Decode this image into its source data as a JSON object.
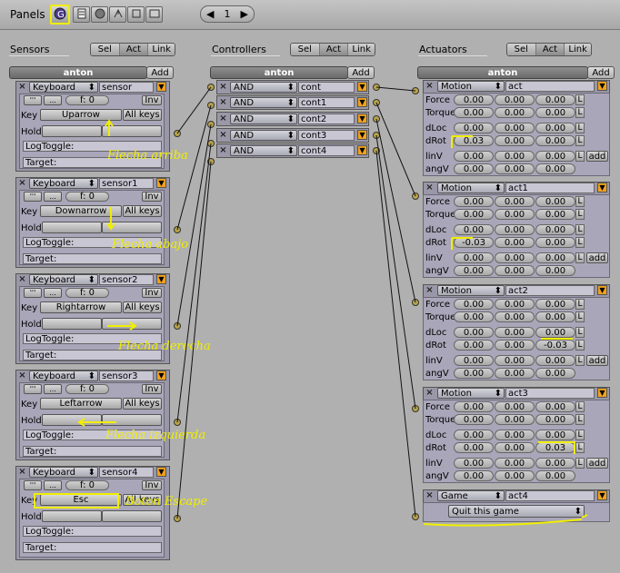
{
  "header": {
    "panels_label": "Panels",
    "page_number": "1",
    "tool_icons": [
      "logic-icon",
      "script-icon",
      "shading-icon",
      "object-icon",
      "editing-icon",
      "scene-icon"
    ]
  },
  "sensors": {
    "title": "Sensors",
    "filters": [
      "Sel",
      "Act",
      "Link"
    ],
    "object": "anton",
    "add": "Add",
    "bricks": [
      {
        "type": "Keyboard",
        "name": "sensor",
        "freq": "f: 0",
        "inv": "Inv",
        "key_label": "Key",
        "key": "Uparrow",
        "all_keys": "All keys",
        "hold": "Hold",
        "logtoggle": "LogToggle:",
        "target": "Target:",
        "note": "Flecha arriba"
      },
      {
        "type": "Keyboard",
        "name": "sensor1",
        "freq": "f: 0",
        "inv": "Inv",
        "key_label": "Key",
        "key": "Downarrow",
        "all_keys": "All keys",
        "hold": "Hold",
        "logtoggle": "LogToggle:",
        "target": "Target:",
        "note": "Flecha abajo"
      },
      {
        "type": "Keyboard",
        "name": "sensor2",
        "freq": "f: 0",
        "inv": "Inv",
        "key_label": "Key",
        "key": "Rightarrow",
        "all_keys": "All keys",
        "hold": "Hold",
        "logtoggle": "LogToggle:",
        "target": "Target:",
        "note": "Flecha derecha"
      },
      {
        "type": "Keyboard",
        "name": "sensor3",
        "freq": "f: 0",
        "inv": "Inv",
        "key_label": "Key",
        "key": "Leftarrow",
        "all_keys": "All keys",
        "hold": "Hold",
        "logtoggle": "LogToggle:",
        "target": "Target:",
        "note": "Flecha izquierda"
      },
      {
        "type": "Keyboard",
        "name": "sensor4",
        "freq": "f: 0",
        "inv": "Inv",
        "key_label": "Key",
        "key": "Esc",
        "all_keys": "All keys",
        "hold": "Hold",
        "logtoggle": "LogToggle:",
        "target": "Target:",
        "note": "Boton Escape"
      }
    ]
  },
  "controllers": {
    "title": "Controllers",
    "filters": [
      "Sel",
      "Act",
      "Link"
    ],
    "object": "anton",
    "add": "Add",
    "bricks": [
      {
        "type": "AND",
        "name": "cont"
      },
      {
        "type": "AND",
        "name": "cont1"
      },
      {
        "type": "AND",
        "name": "cont2"
      },
      {
        "type": "AND",
        "name": "cont3"
      },
      {
        "type": "AND",
        "name": "cont4"
      }
    ]
  },
  "actuators": {
    "title": "Actuators",
    "filters": [
      "Sel",
      "Act",
      "Link"
    ],
    "object": "anton",
    "add": "Add",
    "row_labels": {
      "force": "Force",
      "torque": "Torque",
      "dloc": "dLoc",
      "drot": "dRot",
      "linv": "linV",
      "angv": "angV",
      "l": "L",
      "add": "add"
    },
    "bricks": [
      {
        "type": "Motion",
        "name": "act",
        "force": [
          "0.00",
          "0.00",
          "0.00"
        ],
        "torque": [
          "0.00",
          "0.00",
          "0.00"
        ],
        "dloc": [
          "0.00",
          "0.00",
          "0.00"
        ],
        "drot": [
          "0.03",
          "0.00",
          "0.00"
        ],
        "linv": [
          "0.00",
          "0.00",
          "0.00"
        ],
        "angv": [
          "0.00",
          "0.00",
          "0.00"
        ]
      },
      {
        "type": "Motion",
        "name": "act1",
        "force": [
          "0.00",
          "0.00",
          "0.00"
        ],
        "torque": [
          "0.00",
          "0.00",
          "0.00"
        ],
        "dloc": [
          "0.00",
          "0.00",
          "0.00"
        ],
        "drot": [
          "-0.03",
          "0.00",
          "0.00"
        ],
        "linv": [
          "0.00",
          "0.00",
          "0.00"
        ],
        "angv": [
          "0.00",
          "0.00",
          "0.00"
        ]
      },
      {
        "type": "Motion",
        "name": "act2",
        "force": [
          "0.00",
          "0.00",
          "0.00"
        ],
        "torque": [
          "0.00",
          "0.00",
          "0.00"
        ],
        "dloc": [
          "0.00",
          "0.00",
          "0.00"
        ],
        "drot": [
          "0.00",
          "0.00",
          "-0.03"
        ],
        "linv": [
          "0.00",
          "0.00",
          "0.00"
        ],
        "angv": [
          "0.00",
          "0.00",
          "0.00"
        ]
      },
      {
        "type": "Motion",
        "name": "act3",
        "force": [
          "0.00",
          "0.00",
          "0.00"
        ],
        "torque": [
          "0.00",
          "0.00",
          "0.00"
        ],
        "dloc": [
          "0.00",
          "0.00",
          "0.00"
        ],
        "drot": [
          "0.00",
          "0.00",
          "0.03"
        ],
        "linv": [
          "0.00",
          "0.00",
          "0.00"
        ],
        "angv": [
          "0.00",
          "0.00",
          "0.00"
        ]
      }
    ],
    "game": {
      "type": "Game",
      "name": "act4",
      "mode": "Quit this game"
    }
  },
  "colors": {
    "highlight": "#f0ee00",
    "brick": "#a9a6b9",
    "orange": "#f0a21a",
    "background": "#b0b0b0"
  }
}
